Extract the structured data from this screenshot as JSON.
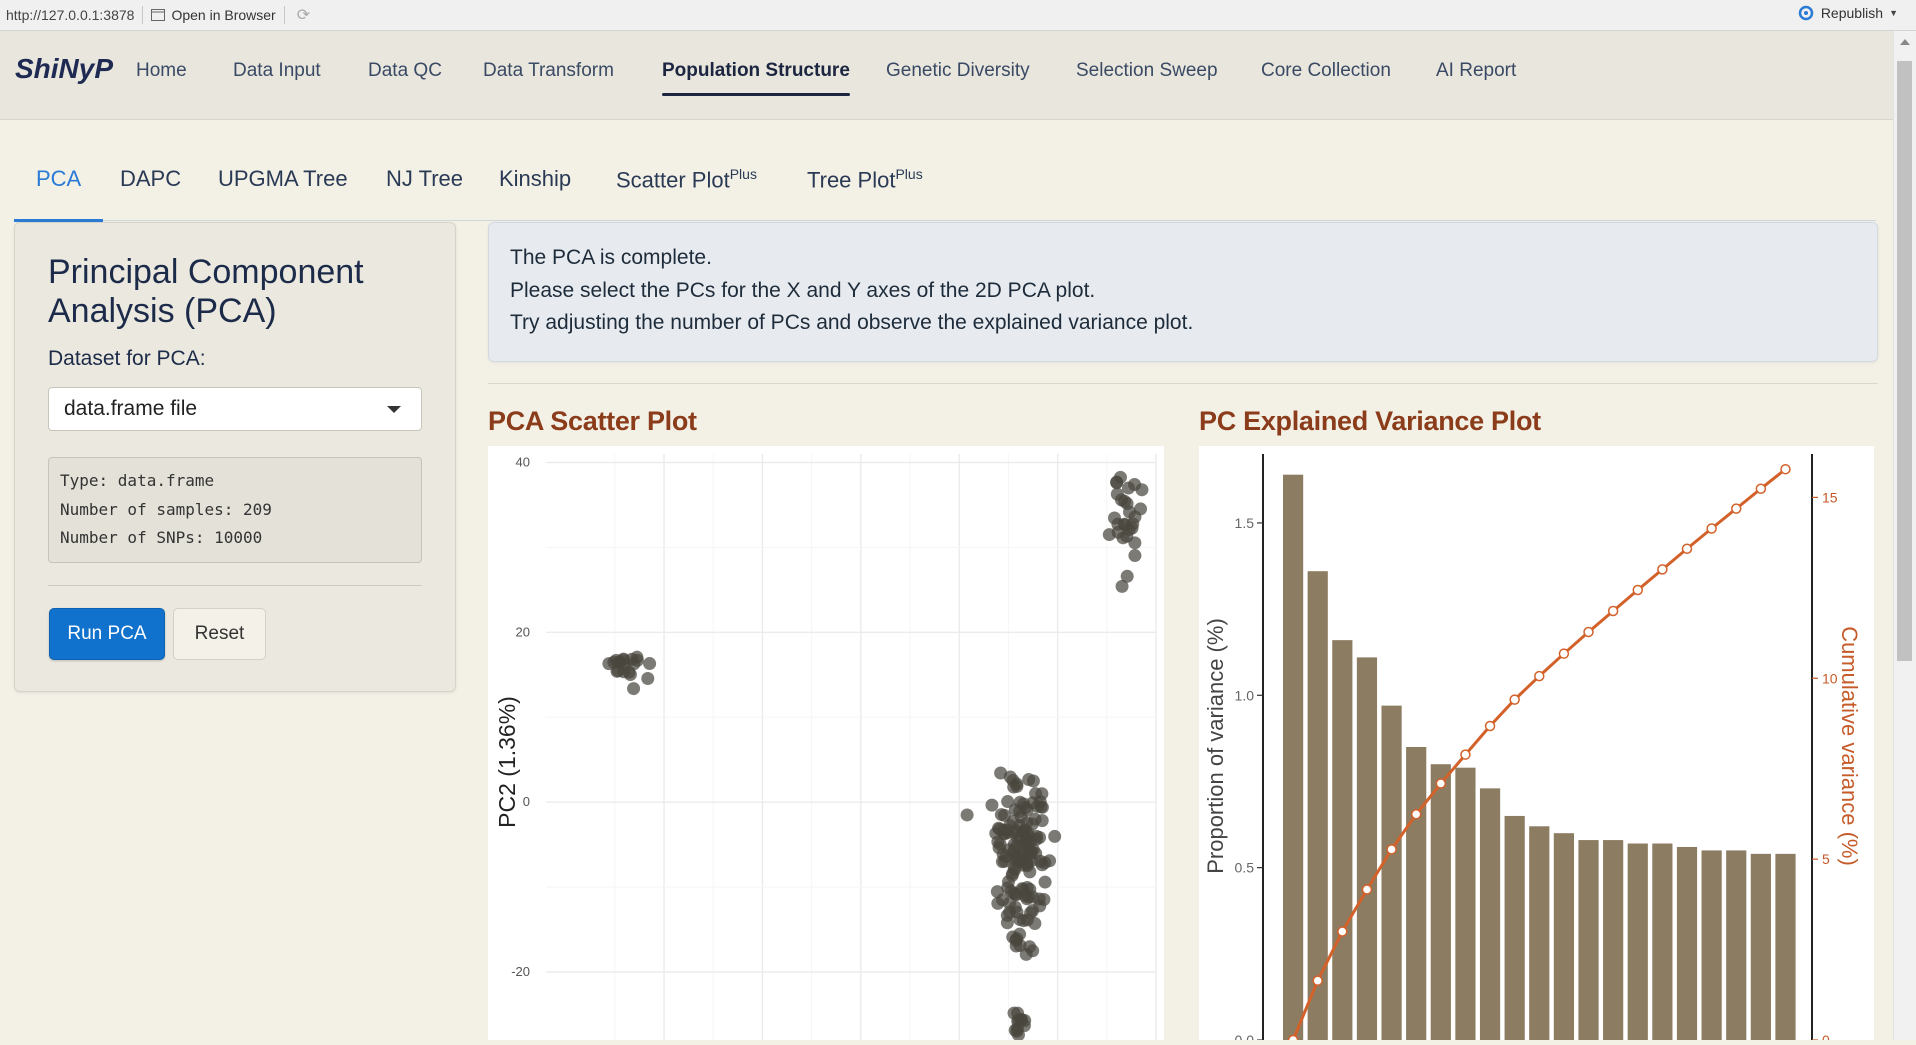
{
  "browser": {
    "url": "http://127.0.0.1:3878",
    "open_in_browser": "Open in Browser",
    "republish": "Republish"
  },
  "app": {
    "brand": "ShiNyP",
    "nav": [
      "Home",
      "Data Input",
      "Data QC",
      "Data Transform",
      "Population Structure",
      "Genetic Diversity",
      "Selection Sweep",
      "Core Collection",
      "AI Report"
    ],
    "active_nav": "Population Structure"
  },
  "tabs": [
    {
      "label": "PCA",
      "sup": ""
    },
    {
      "label": "DAPC",
      "sup": ""
    },
    {
      "label": "UPGMA Tree",
      "sup": ""
    },
    {
      "label": "NJ Tree",
      "sup": ""
    },
    {
      "label": "Kinship",
      "sup": ""
    },
    {
      "label": "Scatter Plot",
      "sup": "Plus"
    },
    {
      "label": "Tree Plot",
      "sup": "Plus"
    }
  ],
  "sidebar": {
    "title": "Principal Component Analysis (PCA)",
    "dataset_label": "Dataset for PCA:",
    "dataset_value": "data.frame file",
    "info_lines": [
      "Type: data.frame",
      "Number of samples: 209",
      "Number of SNPs: 10000"
    ],
    "run_label": "Run PCA",
    "reset_label": "Reset"
  },
  "alert": {
    "lines": [
      "The PCA is complete.",
      "Please select the PCs for the X and Y axes of the 2D PCA plot.",
      "Try adjusting the number of PCs and observe the explained variance plot."
    ]
  },
  "colors": {
    "accent": "#1072cc",
    "tab_active": "#2a7bd6",
    "plot_title": "#8b3c1a",
    "bar": "#8c7c62",
    "line": "#d2612a",
    "point": "#4a463e"
  },
  "chart_data": [
    {
      "type": "scatter",
      "title": "PCA Scatter Plot",
      "ylabel": "PC2 (1.36%)",
      "ylim": [
        -28,
        41
      ],
      "xlim": [
        -55,
        100
      ],
      "yticks": [
        40,
        20,
        0,
        -20
      ],
      "grid": true,
      "clusters": [
        {
          "cx": -35,
          "cy": 16,
          "sx": 2.2,
          "sy": 1.2,
          "n": 20
        },
        {
          "cx": 92,
          "cy": 33,
          "sx": 1.8,
          "sy": 2.6,
          "n": 28
        },
        {
          "cx": 66,
          "cy": -7,
          "sx": 3.0,
          "sy": 4.5,
          "n": 140
        },
        {
          "cx": 65,
          "cy": -26,
          "sx": 1.0,
          "sy": 0.8,
          "n": 12
        }
      ],
      "outliers": [
        {
          "x": 52,
          "y": -1.5
        },
        {
          "x": 71,
          "y": 1
        }
      ]
    },
    {
      "type": "bar",
      "title": "PC Explained Variance Plot",
      "ylabel": "Proportion of variance (%)",
      "y2label": "Cumulative variance (%)",
      "ylim": [
        0,
        1.7
      ],
      "y2lim": [
        0,
        16.2
      ],
      "yticks": [
        0.0,
        0.5,
        1.0,
        1.5
      ],
      "y2ticks": [
        0,
        5,
        10,
        15
      ],
      "values": [
        1.64,
        1.36,
        1.16,
        1.11,
        0.97,
        0.85,
        0.8,
        0.79,
        0.73,
        0.65,
        0.62,
        0.6,
        0.58,
        0.58,
        0.57,
        0.57,
        0.56,
        0.55,
        0.55,
        0.54,
        0.54
      ],
      "cumulative": [
        0.0,
        1.64,
        3.0,
        4.16,
        5.27,
        6.24,
        7.09,
        7.89,
        8.68,
        9.41,
        10.06,
        10.68,
        11.28,
        11.86,
        12.44,
        13.01,
        13.58,
        14.14,
        14.69,
        15.24,
        15.78
      ]
    }
  ]
}
